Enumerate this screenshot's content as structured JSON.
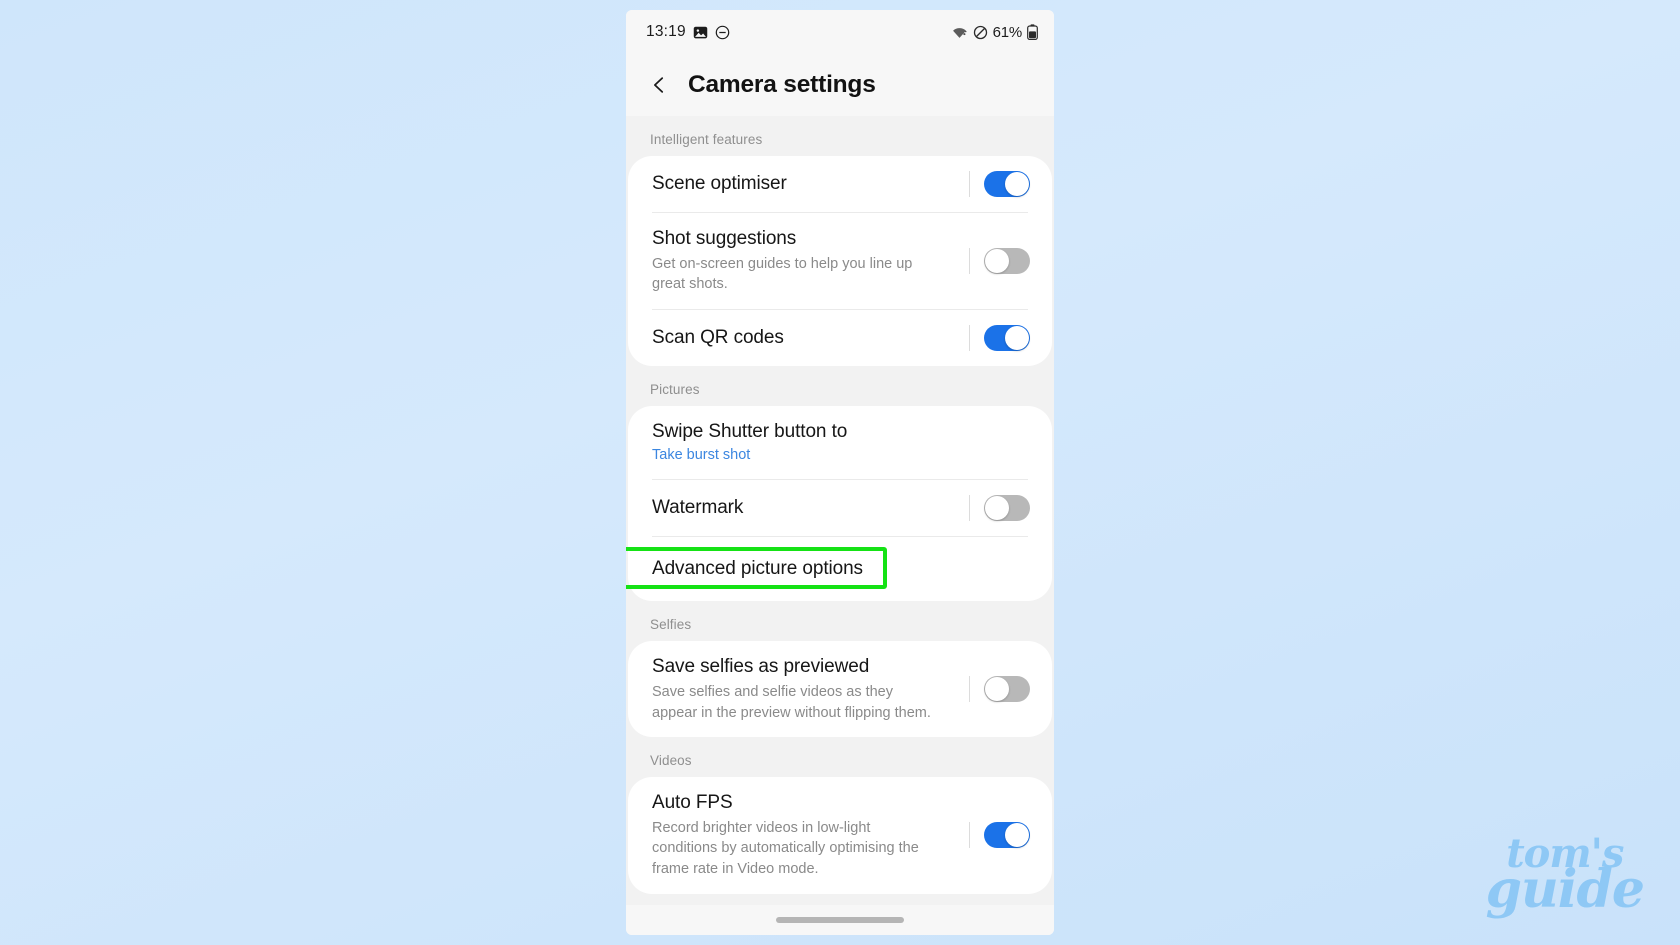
{
  "background": {
    "color_top": "#cfe6fb",
    "color_bottom": "#c9e2fa"
  },
  "watermark": {
    "line1": "tom's",
    "line2": "guide",
    "color": "#8ec8f5"
  },
  "statusbar": {
    "time": "13:19",
    "icons_left": [
      "screenshot-image-icon",
      "do-not-disturb-icon"
    ],
    "icons_right": [
      "wifi-icon",
      "mute-icon"
    ],
    "battery_percent": "61%"
  },
  "header": {
    "title": "Camera settings",
    "back_icon": "back-chevron-icon"
  },
  "accent": {
    "toggle_on": "#1b72e8",
    "toggle_off": "#b8b8b8",
    "link": "#3b86e0",
    "highlight": "#15e215"
  },
  "sections": [
    {
      "label": "Intelligent features",
      "rows": [
        {
          "title": "Scene optimiser",
          "sub": "",
          "control": "toggle",
          "state": "on"
        },
        {
          "title": "Shot suggestions",
          "sub": "Get on-screen guides to help you line up great shots.",
          "control": "toggle",
          "state": "off"
        },
        {
          "title": "Scan QR codes",
          "sub": "",
          "control": "toggle",
          "state": "on"
        }
      ]
    },
    {
      "label": "Pictures",
      "rows": [
        {
          "title": "Swipe Shutter button to",
          "sub": "Take burst shot",
          "control": "link",
          "state": ""
        },
        {
          "title": "Watermark",
          "sub": "",
          "control": "toggle",
          "state": "off"
        },
        {
          "title": "Advanced picture options",
          "sub": "",
          "control": "none",
          "state": "",
          "highlighted": true
        }
      ]
    },
    {
      "label": "Selfies",
      "rows": [
        {
          "title": "Save selfies as previewed",
          "sub": "Save selfies and selfie videos as they appear in the preview without flipping them.",
          "control": "toggle",
          "state": "off"
        }
      ]
    },
    {
      "label": "Videos",
      "rows": [
        {
          "title": "Auto FPS",
          "sub": "Record brighter videos in low-light conditions by automatically optimising the frame rate in Video mode.",
          "control": "toggle",
          "state": "on"
        }
      ]
    }
  ]
}
